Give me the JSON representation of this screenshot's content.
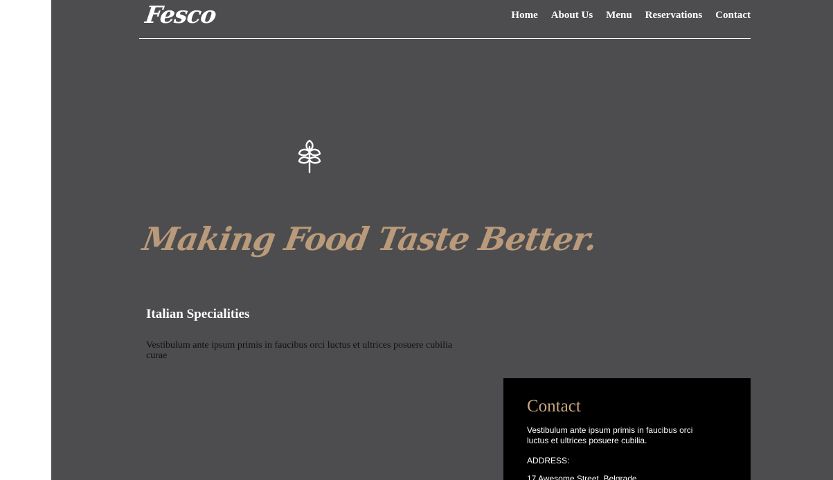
{
  "header": {
    "logo": "Fesco",
    "nav": [
      "Home",
      "About Us",
      "Menu",
      "Reservations",
      "Contact"
    ]
  },
  "hero": {
    "icon": "wheat-icon",
    "tagline": "Making Food Taste Better."
  },
  "specialty": {
    "title": "Italian Specialities",
    "text": "Vestibulum ante ipsum primis in faucibus orci luctus et ultrices posuere cubilia curae"
  },
  "contact": {
    "title": "Contact",
    "text": "Vestibulum ante ipsum primis in faucibus orci luctus et ultrices posuere cubilia.",
    "address_label": "ADDRESS:",
    "address": "17 Awesome Street, Belgrade"
  },
  "colors": {
    "background": "#4d4d4f",
    "accent": "#b99a7a",
    "card": "#000000"
  }
}
